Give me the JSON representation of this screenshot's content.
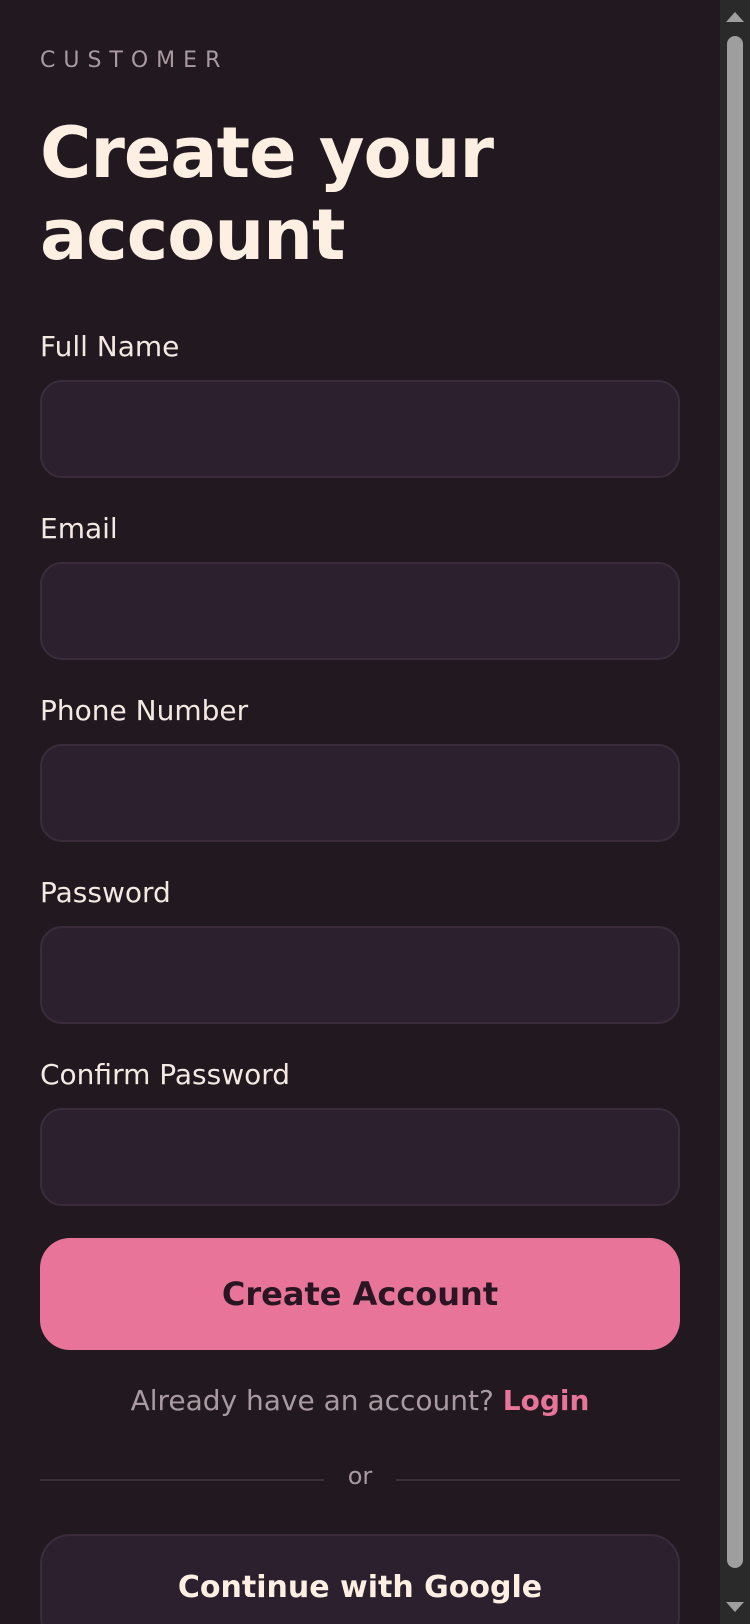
{
  "header": {
    "eyebrow": "CUSTOMER",
    "title": "Create your account"
  },
  "form": {
    "fields": [
      {
        "label": "Full Name",
        "value": "",
        "placeholder": ""
      },
      {
        "label": "Email",
        "value": "",
        "placeholder": ""
      },
      {
        "label": "Phone Number",
        "value": "",
        "placeholder": ""
      },
      {
        "label": "Password",
        "value": "",
        "placeholder": ""
      },
      {
        "label": "Confirm Password",
        "value": "",
        "placeholder": ""
      }
    ],
    "submit_label": "Create Account"
  },
  "login_prompt": {
    "text": "Already have an account?",
    "link_label": "Login"
  },
  "divider": {
    "text": "or"
  },
  "social": {
    "google_label": "Continue with Google"
  },
  "colors": {
    "background": "#221920",
    "accent": "#e87499",
    "input_bg": "#2d202e",
    "title": "#fdf0e3"
  }
}
